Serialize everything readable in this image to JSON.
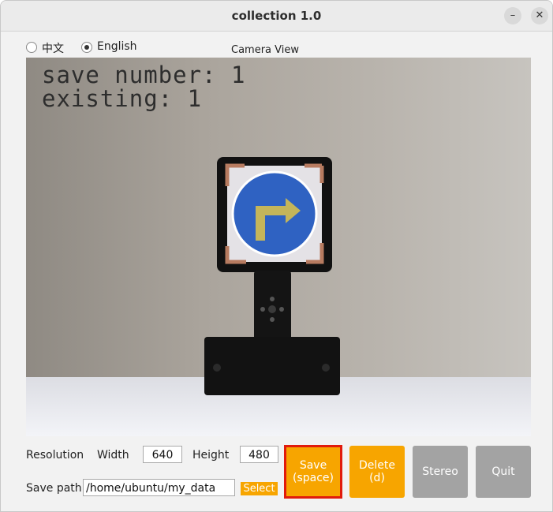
{
  "window": {
    "title": "collection 1.0",
    "minimize_glyph": "–",
    "close_glyph": "✕"
  },
  "language": {
    "options": [
      {
        "label": "中文",
        "selected": false
      },
      {
        "label": "English",
        "selected": true
      }
    ]
  },
  "camera": {
    "label": "Camera View",
    "overlay": {
      "save_number": "save number: 1",
      "existing": "existing: 1"
    },
    "scene": "traffic sign on stand: blue circle with yellow right-turn arrow"
  },
  "controls": {
    "resolution_label": "Resolution",
    "width_label": "Width",
    "width_value": "640",
    "height_label": "Height",
    "height_value": "480",
    "save_path_label": "Save path",
    "save_path_value": "/home/ubuntu/my_data",
    "select_label": "Select"
  },
  "buttons": {
    "save": "Save\n(space)",
    "delete": "Delete\n(d)",
    "stereo": "Stereo",
    "quit": "Quit"
  },
  "colors": {
    "accent_orange": "#f7a500",
    "disabled_gray": "#a3a3a3",
    "highlight_red": "#e11b0c",
    "sign_blue": "#2f62c2",
    "arrow_yellow": "#c4b55a"
  }
}
